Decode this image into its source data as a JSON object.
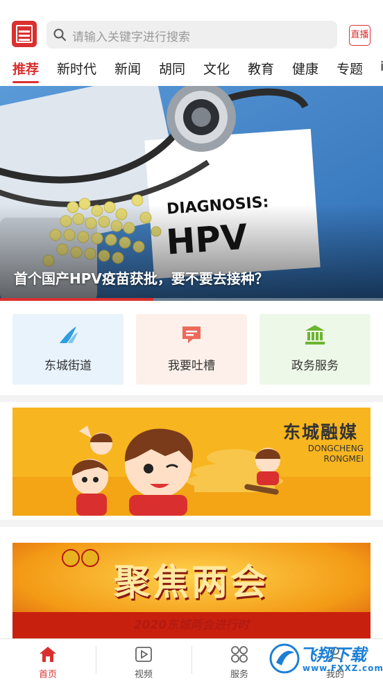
{
  "search": {
    "placeholder": "请输入关键字进行搜索"
  },
  "header": {
    "live_label": "直播"
  },
  "tabs": [
    {
      "label": "推荐"
    },
    {
      "label": "新时代"
    },
    {
      "label": "新闻"
    },
    {
      "label": "胡同"
    },
    {
      "label": "文化"
    },
    {
      "label": "教育"
    },
    {
      "label": "健康"
    },
    {
      "label": "专题"
    },
    {
      "label": "i"
    }
  ],
  "banner": {
    "title": "首个国产HPV疫苗获批，要不要去接种？",
    "card_line1": "DIAGNOSIS:",
    "card_line2": "HPV",
    "progress": 0.4
  },
  "entries": [
    {
      "label": "东城街道",
      "icon": "wave-icon",
      "bg": "#e8f3fb",
      "color": "#2d9ee0"
    },
    {
      "label": "我要吐槽",
      "icon": "chat-bubble-icon",
      "bg": "#fdf0ea",
      "color": "#ec6a5a"
    },
    {
      "label": "政务服务",
      "icon": "government-building-icon",
      "bg": "#eef8e8",
      "color": "#6cb52f"
    }
  ],
  "ads": {
    "rongmei_title": "东城融媒",
    "rongmei_sub1": "DONGCHENG",
    "rongmei_sub2": "RONGMEI",
    "lianghui_title": "聚焦两会",
    "lianghui_sub": "2020东城两会进行时"
  },
  "bottom_nav": [
    {
      "label": "首页",
      "icon": "home-icon"
    },
    {
      "label": "视频",
      "icon": "video-play-icon"
    },
    {
      "label": "服务",
      "icon": "grid-icon"
    },
    {
      "label": "我的",
      "icon": "user-icon"
    }
  ],
  "watermark": {
    "text1": "飞翔下载",
    "text2": "www.FXXZ.com"
  },
  "colors": {
    "accent": "#d9302f"
  }
}
